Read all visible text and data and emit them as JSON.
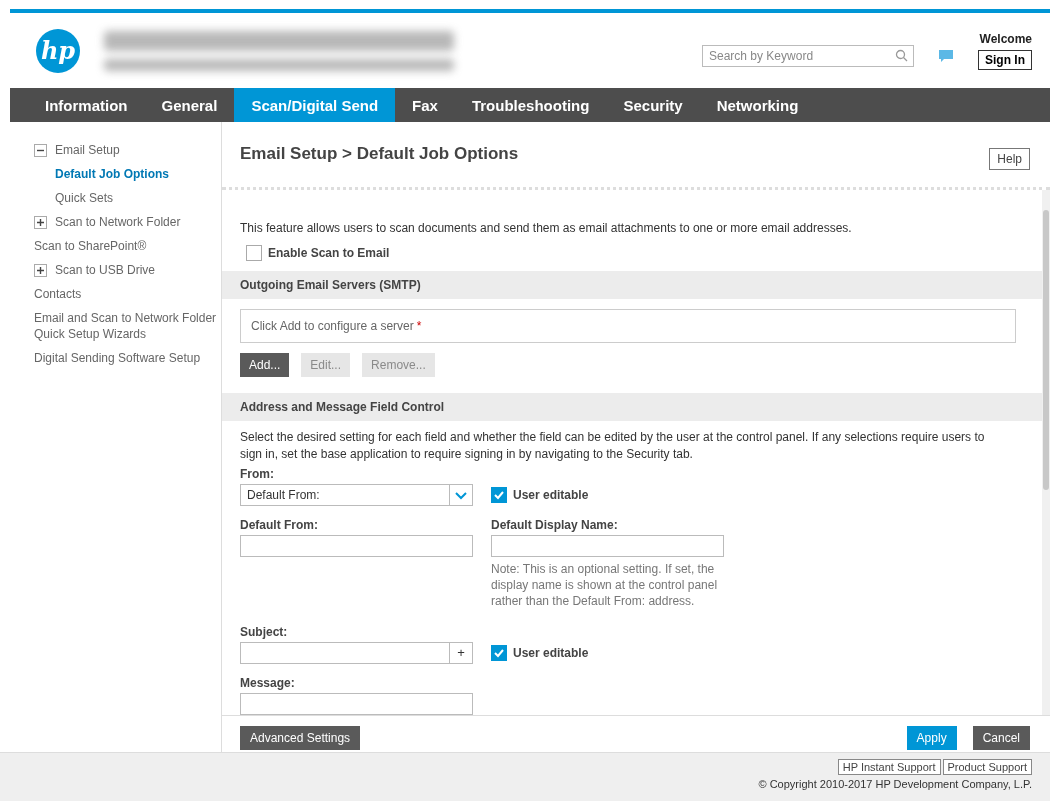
{
  "header": {
    "logo": "hp",
    "search": {
      "placeholder": "Search by Keyword"
    },
    "welcome": "Welcome",
    "sign_in": "Sign In"
  },
  "tabs": [
    {
      "label": "Information",
      "selected": false
    },
    {
      "label": "General",
      "selected": false
    },
    {
      "label": "Scan/Digital Send",
      "selected": true
    },
    {
      "label": "Fax",
      "selected": false
    },
    {
      "label": "Troubleshooting",
      "selected": false
    },
    {
      "label": "Security",
      "selected": false
    },
    {
      "label": "Networking",
      "selected": false
    }
  ],
  "sidebar": {
    "items": [
      {
        "label": "Email Setup",
        "expanded": true,
        "selected": false,
        "children": [
          {
            "label": "Default Job Options",
            "selected": true
          },
          {
            "label": "Quick Sets",
            "selected": false
          }
        ]
      },
      {
        "label": "Scan to Network Folder",
        "expanded": false,
        "selected": false
      },
      {
        "label": "Scan to SharePoint®",
        "selected": false
      },
      {
        "label": "Scan to USB Drive",
        "expanded": false,
        "selected": false
      },
      {
        "label": "Contacts",
        "selected": false
      },
      {
        "label": "Email and Scan to Network Folder Quick Setup Wizards",
        "selected": false
      },
      {
        "label": "Digital Sending Software Setup",
        "selected": false
      }
    ]
  },
  "page": {
    "title": "Email Setup > Default Job Options",
    "help": "Help",
    "intro": "This feature allows users to scan documents and send them as email attachments to one or more email addresses.",
    "enable": {
      "label": "Enable Scan to Email",
      "checked": false
    },
    "smtp": {
      "heading": "Outgoing Email Servers (SMTP)",
      "placeholder": "Click Add to configure a server",
      "required": "*",
      "buttons": [
        {
          "label": "Add...",
          "disabled": false
        },
        {
          "label": "Edit...",
          "disabled": true
        },
        {
          "label": "Remove...",
          "disabled": true
        }
      ]
    },
    "fields": {
      "heading": "Address and Message Field Control",
      "description": "Select the desired setting for each field and whether the field can be edited by the user at the control panel. If any selections require users to sign in, set the base application to require signing in by navigating to the Security tab.",
      "from": {
        "label": "From:",
        "value": "Default From:",
        "user_editable": {
          "label": "User editable",
          "checked": true
        }
      },
      "default_from": {
        "label": "Default From:"
      },
      "display_name": {
        "label": "Default Display Name:",
        "note": "Note: This is an optional setting. If set, the display name is shown at the control panel rather than the Default From: address."
      },
      "subject": {
        "label": "Subject:",
        "add": "+",
        "user_editable": {
          "label": "User editable",
          "checked": true
        }
      },
      "message": {
        "label": "Message:"
      }
    }
  },
  "actions": {
    "advanced": "Advanced Settings",
    "apply": "Apply",
    "cancel": "Cancel"
  },
  "footer": {
    "links": [
      "HP Instant Support",
      "Product Support"
    ],
    "copyright": "© Copyright 2010-2017 HP Development Company, L.P."
  }
}
